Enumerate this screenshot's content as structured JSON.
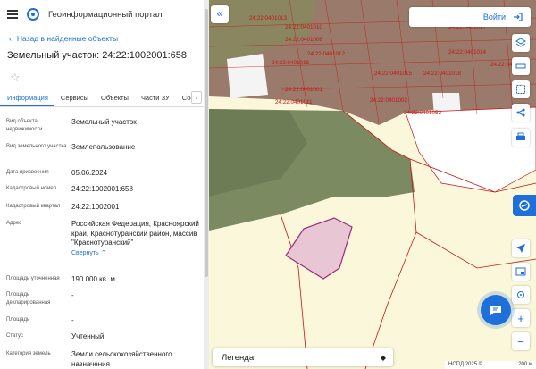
{
  "header": {
    "portal_title": "Геоинформационный портал"
  },
  "nav": {
    "back_label": "Назад в найденные объекты"
  },
  "object": {
    "title": "Земельный участок: 24:22:1002001:658"
  },
  "tabs": [
    "Информация",
    "Сервисы",
    "Объекты",
    "Части ЗУ",
    "Сост"
  ],
  "properties": [
    {
      "label": "Вид объекта недвижимости",
      "value": "Земельный участок"
    },
    {
      "label": "Вид земельного участка",
      "value": "Землепользование"
    },
    {
      "label": "Дата присвоения",
      "value": "05.06.2024"
    },
    {
      "label": "Кадастровый номер",
      "value": "24:22:1002001:658"
    },
    {
      "label": "Кадастровый квартал",
      "value": "24:22:1002001"
    },
    {
      "label": "Адрес",
      "value": "Российская Федерация, Красноярский край, Краснотуранский район, массив \"Краснотуранский\"",
      "action": "Свернуть"
    },
    {
      "label": "Площадь уточненная",
      "value": "190 000 кв. м"
    },
    {
      "label": "Площадь декларированная",
      "value": "-"
    },
    {
      "label": "Площадь",
      "value": "-"
    },
    {
      "label": "Статус",
      "value": "Учтенный"
    },
    {
      "label": "Категория земель",
      "value": "Земли сельскохозяйственного назначения"
    }
  ],
  "map": {
    "login_label": "Войти",
    "legend_label": "Легенда",
    "scale_left": "НСПД 2025 ©",
    "scale_right": "200 м",
    "parcel_labels": [
      "24:22:0401013",
      "24:22:0401010",
      "24:22:0401008",
      "24:22:0401017",
      "24:22:0401012",
      "24:22:0401014",
      "24:22:0401003",
      "24:22:0401016",
      "24:22:0401015",
      "24:22:0401018",
      "24:22:0401001",
      "24:22:0401002",
      "24:22:0401011",
      "24:22:0401052"
    ]
  },
  "icons": [
    "menu-icon",
    "portal-logo-icon",
    "chevron-left-icon",
    "star-icon",
    "login-icon",
    "layers-icon",
    "ruler-icon",
    "select-area-icon",
    "share-icon",
    "print-icon",
    "navigate-icon",
    "screen-icon",
    "locate-icon",
    "zoom-in-icon",
    "zoom-out-icon",
    "chat-icon",
    "chevron-down-icon",
    "collapse-icon"
  ],
  "colors": {
    "accent": "#1e6fd9",
    "parcel_border": "#9b2b7d",
    "boundary": "#c81414"
  }
}
